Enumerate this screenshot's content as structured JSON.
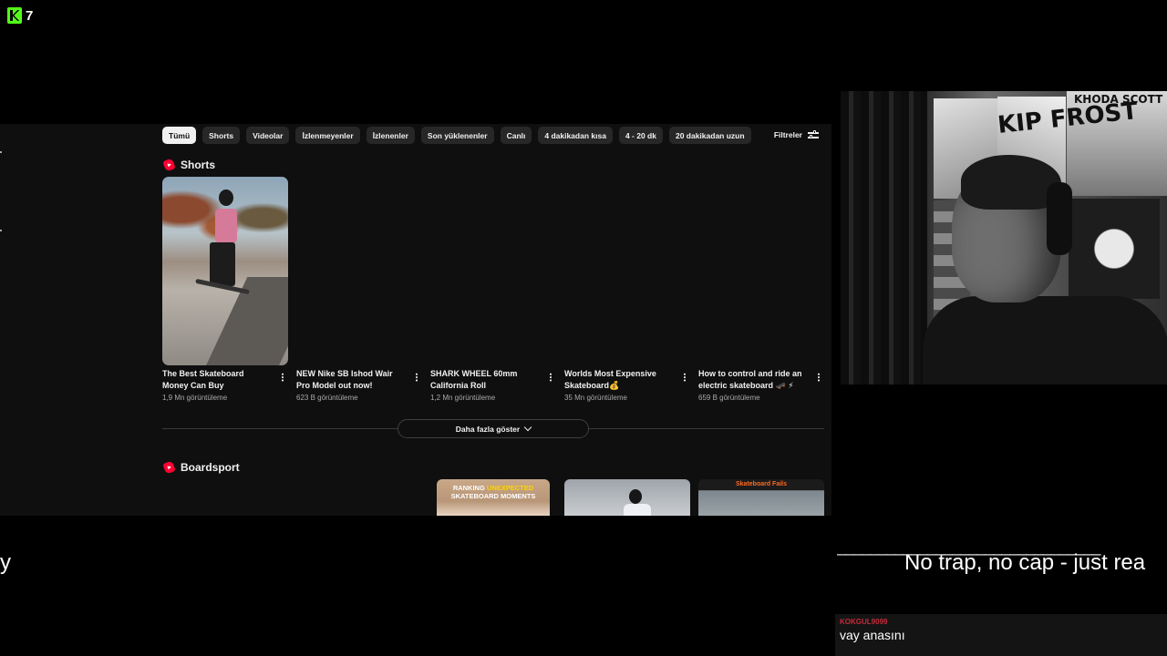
{
  "overlay": {
    "logo_number": "7",
    "left_caption_fragment": "y",
    "dash_line": "________________________________",
    "caption": "No trap, no cap - just rea"
  },
  "youtube": {
    "chips": [
      "Tümü",
      "Shorts",
      "Videolar",
      "İzlenmeyenler",
      "İzlenenler",
      "Son yüklenenler",
      "Canlı",
      "4 dakikadan kısa",
      "4 - 20 dk",
      "20 dakikadan uzun"
    ],
    "filters_label": "Filtreler",
    "shorts_section_title": "Shorts",
    "shorts": [
      {
        "title": "The Best Skateboard Money Can Buy",
        "views": "1,9 Mn görüntüleme"
      },
      {
        "title": "NEW Nike SB Ishod Wair Pro Model out now!",
        "views": "623 B görüntüleme"
      },
      {
        "title": "SHARK WHEEL 60mm California Roll",
        "views": "1,2 Mn görüntüleme"
      },
      {
        "title": "Worlds Most Expensive Skateboard💰",
        "views": "35 Mn görüntüleme"
      },
      {
        "title": "How to control and ride an electric skateboard 🛹 ⚡",
        "views": "659 B görüntüleme"
      }
    ],
    "show_more_label": "Daha fazla göster",
    "boardsport_section_title": "Boardsport",
    "boardsport_thumb1_line1": "RANKING",
    "boardsport_thumb1_highlight": "UNEXPECTED",
    "boardsport_thumb1_line2": "SKATEBOARD MOMENTS",
    "boardsport_thumb3_text": "Skateboard Fails"
  },
  "webcam": {
    "poster_text_1": "KHODA SCOTT",
    "poster_text_2": "KIP FROST"
  },
  "chat": {
    "username": "KOKGUL9099",
    "message": "vay anasını",
    "username_color": "#c72b3a"
  },
  "colors": {
    "kick_green": "#53fc18",
    "youtube_red": "#ff0033"
  }
}
